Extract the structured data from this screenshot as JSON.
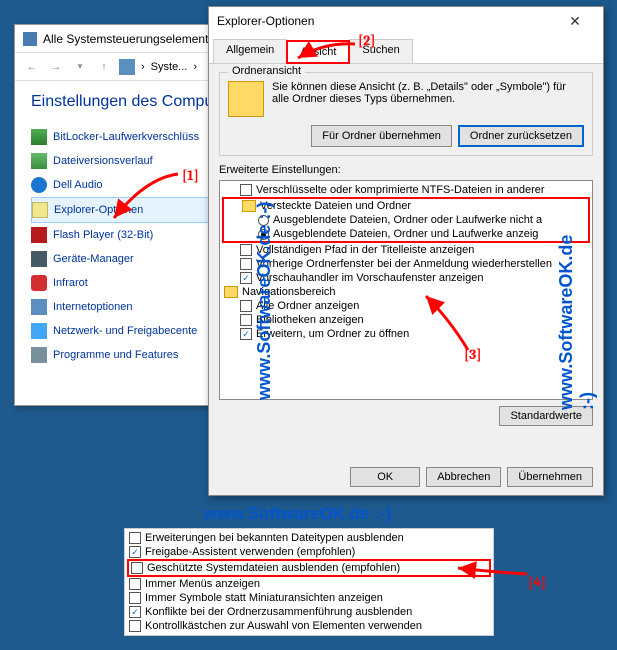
{
  "cp": {
    "title": "Alle Systemsteuerungselemente",
    "crumb": "Syste...",
    "heading": "Einstellungen des Compu",
    "items": [
      {
        "label": "BitLocker-Laufwerkverschlüss"
      },
      {
        "label": "Dateiversionsverlauf"
      },
      {
        "label": "Dell Audio"
      },
      {
        "label": "Explorer-Optionen"
      },
      {
        "label": "Flash Player (32-Bit)"
      },
      {
        "label": "Geräte-Manager"
      },
      {
        "label": "Infrarot"
      },
      {
        "label": "Internetoptionen"
      },
      {
        "label": "Netzwerk- und Freigabecente"
      },
      {
        "label": "Programme und Features"
      }
    ]
  },
  "dlg": {
    "title": "Explorer-Optionen",
    "tabs": {
      "general": "Allgemein",
      "view": "Ansicht",
      "search": "Suchen"
    },
    "folderview_label": "Ordneransicht",
    "folderview_text": "Sie können diese Ansicht (z. B. „Details\" oder „Symbole\") für alle Ordner dieses Typs übernehmen.",
    "btn_apply_folders": "Für Ordner übernehmen",
    "btn_reset_folders": "Ordner zurücksetzen",
    "advanced_label": "Erweiterte Einstellungen:",
    "tree": [
      {
        "type": "chk",
        "checked": false,
        "label": "Verschlüsselte oder komprimierte NTFS-Dateien in anderer"
      },
      {
        "type": "folder",
        "label": "Versteckte Dateien und Ordner"
      },
      {
        "type": "radio",
        "checked": false,
        "label": "Ausgeblendete Dateien, Ordner oder Laufwerke nicht a"
      },
      {
        "type": "radio",
        "checked": true,
        "label": "Ausgeblendete Dateien, Ordner und Laufwerke anzeig"
      },
      {
        "type": "chk",
        "checked": false,
        "label": "Vollständigen Pfad in der Titelleiste anzeigen"
      },
      {
        "type": "chk",
        "checked": false,
        "label": "Vorherige Ordnerfenster bei der Anmeldung wiederherstellen"
      },
      {
        "type": "chk",
        "checked": true,
        "label": "Vorschauhandler im Vorschaufenster anzeigen"
      },
      {
        "type": "folder",
        "label": "Navigationsbereich"
      },
      {
        "type": "chk",
        "checked": false,
        "label": "Alle Ordner anzeigen"
      },
      {
        "type": "chk",
        "checked": false,
        "label": "Bibliotheken anzeigen"
      },
      {
        "type": "chk",
        "checked": true,
        "label": "Erweitern, um Ordner zu öffnen"
      }
    ],
    "btn_defaults": "Standardwerte",
    "btn_ok": "OK",
    "btn_cancel": "Abbrechen",
    "btn_apply": "Übernehmen"
  },
  "ext": [
    {
      "checked": false,
      "label": "Erweiterungen bei bekannten Dateitypen ausblenden"
    },
    {
      "checked": true,
      "label": "Freigabe-Assistent verwenden (empfohlen)"
    },
    {
      "checked": false,
      "label": "Geschützte Systemdateien ausblenden (empfohlen)",
      "hl": true
    },
    {
      "checked": false,
      "label": "Immer Menüs anzeigen"
    },
    {
      "checked": false,
      "label": "Immer Symbole statt Miniaturansichten anzeigen"
    },
    {
      "checked": true,
      "label": "Konflikte bei der Ordnerzusammenführung ausblenden"
    },
    {
      "checked": false,
      "label": "Kontrollkästchen zur Auswahl von Elementen verwenden"
    }
  ],
  "callouts": {
    "c1": "[1]",
    "c2": "[2]",
    "c3": "[3]",
    "c4": "[4]"
  },
  "watermark": "www.SoftwareOK.de :-)"
}
